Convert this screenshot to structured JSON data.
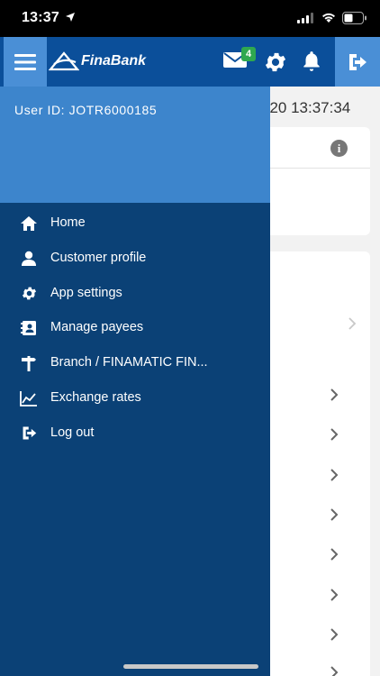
{
  "status_bar": {
    "time": "13:37"
  },
  "header": {
    "brand": "FinaBank",
    "mail_badge": "4"
  },
  "background": {
    "date_text": "020 13:37:34"
  },
  "drawer": {
    "user_id": "User ID: JOTR6000185",
    "items": [
      {
        "label": "Home",
        "icon": "home-icon"
      },
      {
        "label": "Customer profile",
        "icon": "user-icon"
      },
      {
        "label": "App settings",
        "icon": "gear-icon"
      },
      {
        "label": "Manage payees",
        "icon": "contacts-icon"
      },
      {
        "label": "Branch / FINAMATIC FIN...",
        "icon": "signpost-icon"
      },
      {
        "label": "Exchange rates",
        "icon": "chart-icon"
      },
      {
        "label": "Log out",
        "icon": "logout-icon"
      }
    ]
  },
  "colors": {
    "header": "#0b4f9a",
    "drawer": "#0b4176",
    "drawer_head": "#3d85cc",
    "accent": "#4a8fd6",
    "badge": "#2fa84f"
  }
}
